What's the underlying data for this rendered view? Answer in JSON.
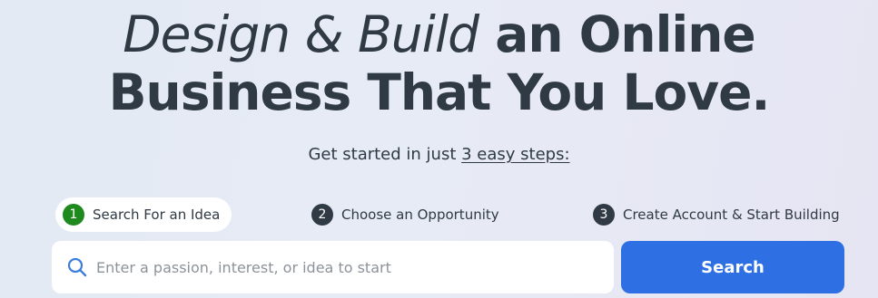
{
  "hero": {
    "headline_italic": "Design & Build",
    "headline_line1_rest": "an Online",
    "headline_line2": "Business That You Love."
  },
  "subhead": {
    "prefix": "Get started in just ",
    "link_text": "3 easy steps:"
  },
  "steps": [
    {
      "number": "1",
      "label": "Search For an Idea",
      "active": true
    },
    {
      "number": "2",
      "label": "Choose an Opportunity",
      "active": false
    },
    {
      "number": "3",
      "label": "Create Account & Start Building",
      "active": false
    }
  ],
  "search": {
    "placeholder": "Enter a passion, interest, or idea to start",
    "value": "",
    "button_label": "Search",
    "icon": "search-icon"
  },
  "colors": {
    "text": "#2f3a44",
    "primary_button": "#2f6fe4",
    "active_step": "#1e8a1e",
    "search_icon": "#3b7ddd"
  }
}
